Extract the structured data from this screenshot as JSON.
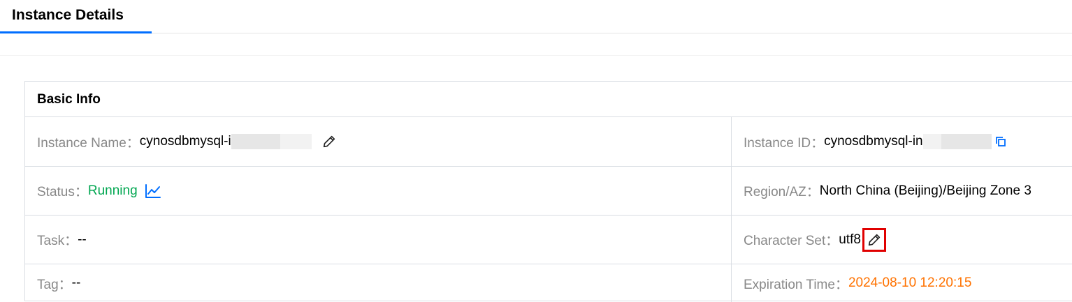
{
  "header": {
    "tab_label": "Instance Details"
  },
  "basic_info": {
    "title": "Basic Info",
    "instance_name": {
      "label": "Instance Name：",
      "value": "cynosdbmysql-i"
    },
    "instance_id": {
      "label": "Instance ID：",
      "value": "cynosdbmysql-in"
    },
    "status": {
      "label": "Status：",
      "value": "Running"
    },
    "region": {
      "label": "Region/AZ：",
      "value": "North China (Beijing)/Beijing Zone 3"
    },
    "task": {
      "label": "Task：",
      "value": "--"
    },
    "charset": {
      "label": "Character Set：",
      "value": "utf8"
    },
    "tag": {
      "label": "Tag：",
      "value": "--"
    },
    "expiration": {
      "label": "Expiration Time：",
      "value": "2024-08-10 12:20:15"
    }
  },
  "colors": {
    "accent": "#006eff",
    "running": "#00a650",
    "expiration": "#ff7200",
    "highlight": "#e00000"
  },
  "icons": [
    "pencil-icon",
    "copy-icon",
    "chart-line-icon"
  ]
}
